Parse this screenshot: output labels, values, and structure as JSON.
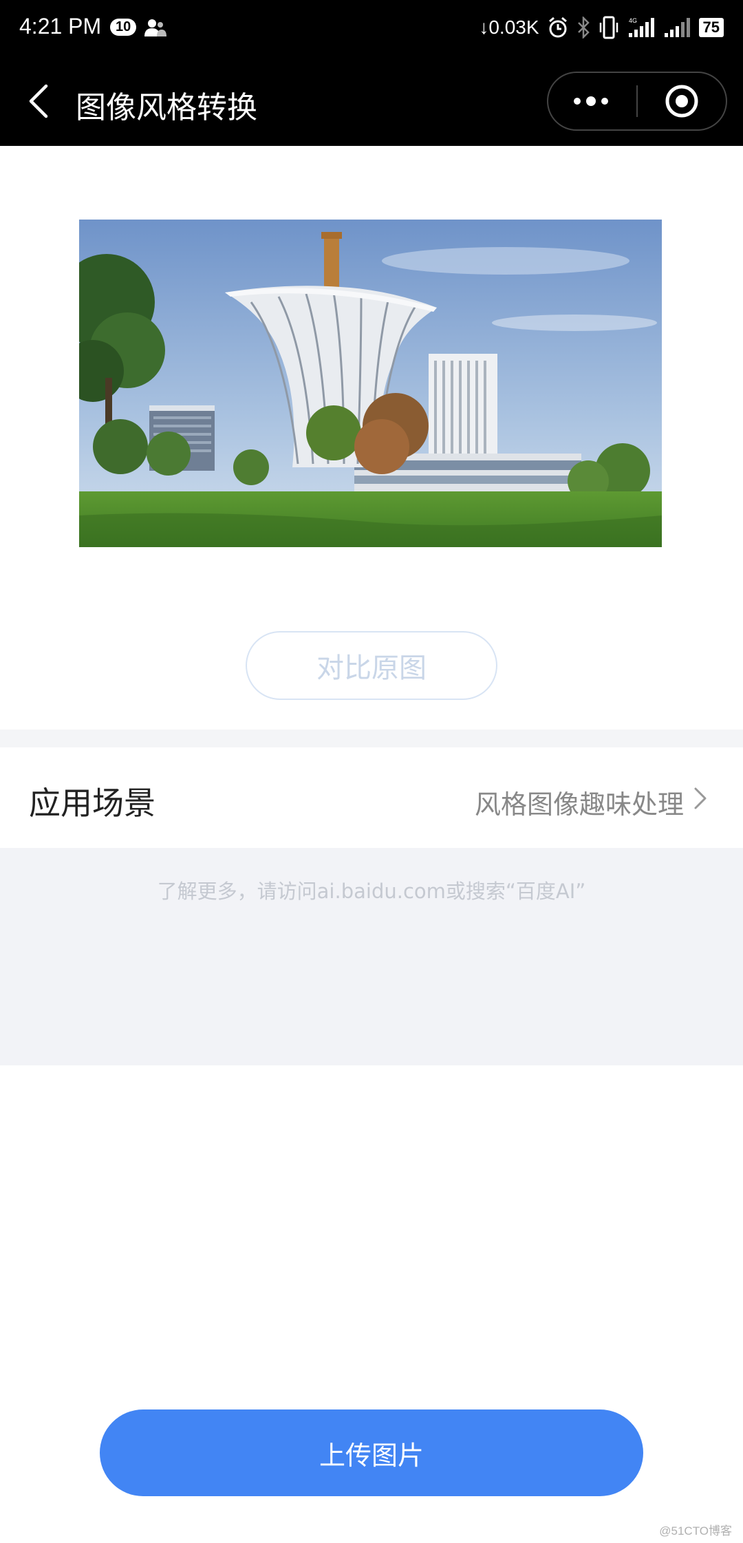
{
  "status_bar": {
    "time": "4:21 PM",
    "notification_count": "10",
    "net_speed": "↓0.03K",
    "network_type": "4G",
    "battery": "75",
    "icons": [
      "person-icon",
      "alarm-icon",
      "bluetooth-icon",
      "vibrate-icon",
      "signal-icon",
      "signal-icon-2",
      "battery-icon"
    ]
  },
  "nav": {
    "title": "图像风格转换",
    "back_icon": "chevron-left-icon",
    "more_icon": "more-dots-icon",
    "close_icon": "target-circle-icon"
  },
  "preview": {
    "image_alt": "campus building photo",
    "compare_label": "对比原图"
  },
  "scene": {
    "label": "应用场景",
    "value": "风格图像趣味处理"
  },
  "footer": {
    "text": "了解更多，请访问ai.baidu.com或搜索“百度AI”"
  },
  "upload": {
    "label": "上传图片"
  },
  "watermark": "@51CTO博客",
  "colors": {
    "accent": "#4285f4",
    "nav_bg": "#000000",
    "footer_bg": "#f2f3f7"
  }
}
